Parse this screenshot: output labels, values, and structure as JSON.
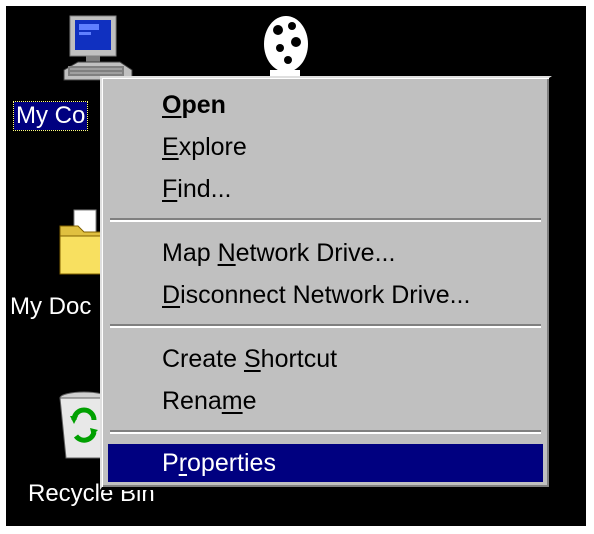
{
  "desktop": {
    "icons": {
      "my_computer": {
        "label_visible": "My Co"
      },
      "my_documents": {
        "label_visible": "My Doc"
      },
      "recycle_bin": {
        "label_visible": "Recycle Bin"
      }
    }
  },
  "context_menu": {
    "items": {
      "open": {
        "pre": "",
        "key": "O",
        "post": "pen"
      },
      "explore": {
        "pre": "",
        "key": "E",
        "post": "xplore"
      },
      "find": {
        "pre": "",
        "key": "F",
        "post": "ind..."
      },
      "map": {
        "pre": "Map ",
        "key": "N",
        "post": "etwork Drive..."
      },
      "disconnect": {
        "pre": "",
        "key": "D",
        "post": "isconnect Network Drive..."
      },
      "shortcut": {
        "pre": "Create ",
        "key": "S",
        "post": "hortcut"
      },
      "rename": {
        "pre": "Rena",
        "key": "m",
        "post": "e"
      },
      "properties": {
        "pre": "P",
        "key": "r",
        "post": "operties"
      }
    }
  },
  "colors": {
    "desktop": "#000000",
    "menu_face": "#c0c0c0",
    "highlight": "#000080",
    "highlight_text": "#ffffff"
  }
}
